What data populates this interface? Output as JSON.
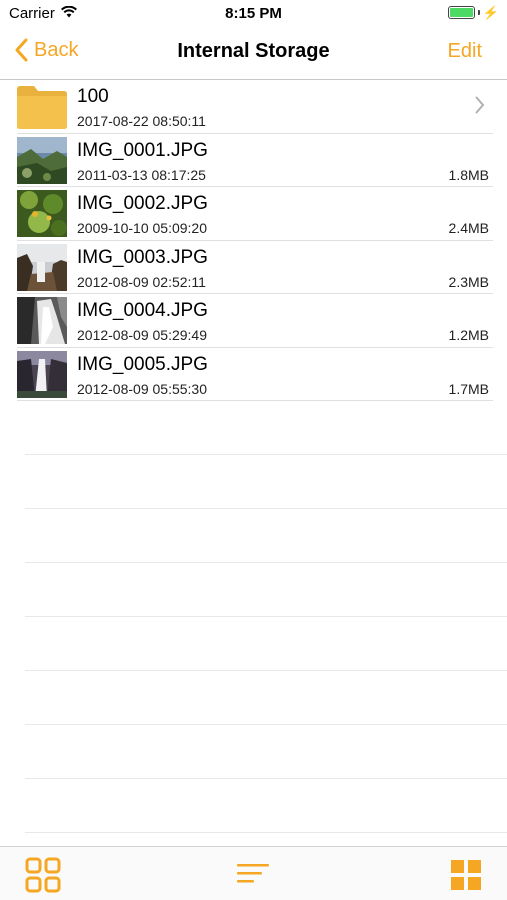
{
  "status_bar": {
    "carrier": "Carrier",
    "time": "8:15 PM",
    "wifi_icon": "wifi-icon",
    "battery_icon": "battery-charging-icon",
    "battery_color": "#4cd964"
  },
  "nav": {
    "back_label": "Back",
    "title": "Internal Storage",
    "edit_label": "Edit",
    "accent_color": "#f5a623"
  },
  "files": [
    {
      "type": "folder",
      "name": "100",
      "date": "2017-08-22 08:50:11",
      "size": ""
    },
    {
      "type": "image",
      "name": "IMG_0001.JPG",
      "date": "2011-03-13 08:17:25",
      "size": "1.8MB"
    },
    {
      "type": "image",
      "name": "IMG_0002.JPG",
      "date": "2009-10-10 05:09:20",
      "size": "2.4MB"
    },
    {
      "type": "image",
      "name": "IMG_0003.JPG",
      "date": "2012-08-09 02:52:11",
      "size": "2.3MB"
    },
    {
      "type": "image",
      "name": "IMG_0004.JPG",
      "date": "2012-08-09 05:29:49",
      "size": "1.2MB"
    },
    {
      "type": "image",
      "name": "IMG_0005.JPG",
      "date": "2012-08-09 05:55:30",
      "size": "1.7MB"
    }
  ],
  "tab_bar": {
    "left_icon": "grid-outline-icon",
    "center_icon": "sort-lines-icon",
    "right_icon": "grid-filled-icon"
  }
}
